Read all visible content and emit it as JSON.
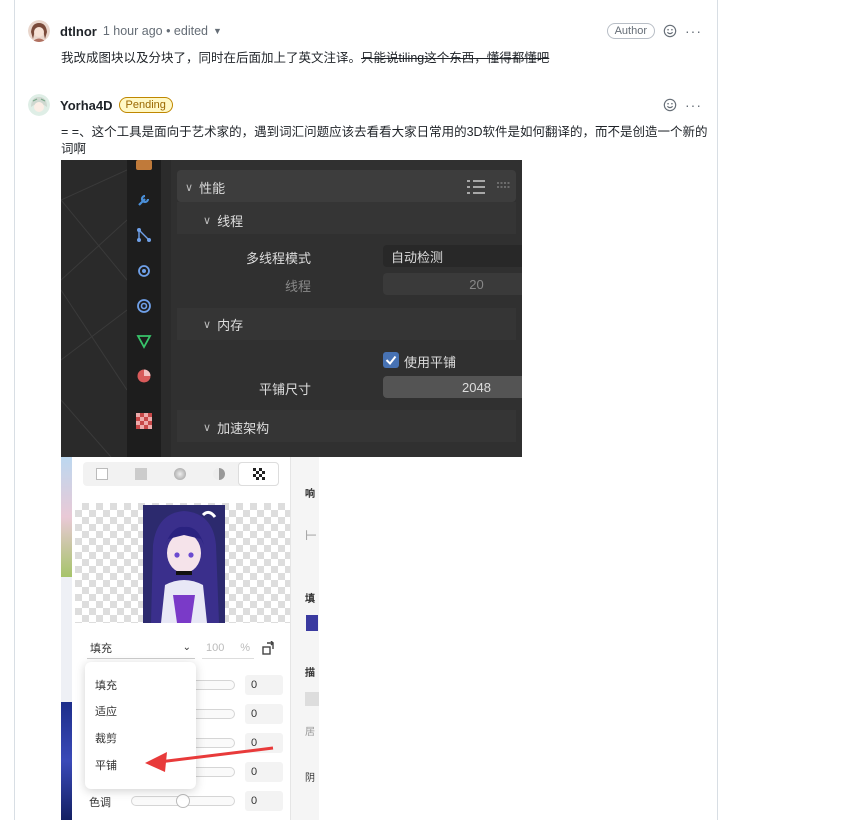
{
  "comments": [
    {
      "author": "dtlnor",
      "meta": "1 hour ago • edited",
      "badge": "Author",
      "body_plain": "我改成图块以及分块了，同时在后面加上了英文注译。",
      "body_struck": "只能说tiling这个东西，懂得都懂吧"
    },
    {
      "author": "Yorha4D",
      "badge": "Pending",
      "body": "= =、这个工具是面向于艺术家的，遇到词汇问题应该去看看大家日常用的3D软件是如何翻译的，而不是创造一个新的词啊"
    }
  ],
  "blender": {
    "section_perf": "性能",
    "sub_thread": "线程",
    "label_mt_mode": "多线程模式",
    "mt_mode_value": "自动检测",
    "label_threads": "线程",
    "threads_value": "20",
    "sub_memory": "内存",
    "use_tiling_label": "使用平铺",
    "label_tile_size": "平铺尺寸",
    "tile_size_value": "2048",
    "sub_accel": "加速架构"
  },
  "fill_panel": {
    "selected_mode": "填充",
    "percent_value": "100",
    "percent_unit": "%",
    "menu_items": [
      "填充",
      "适应",
      "裁剪",
      "平铺"
    ],
    "slider_values": [
      "0",
      "0",
      "0",
      "0",
      "0"
    ],
    "hue_label": "色调",
    "right_labels": [
      "响",
      "填",
      "描",
      "居",
      "阴"
    ]
  },
  "colors": {
    "accent_blue": "#4772b3",
    "arrow_red": "#e83a3a",
    "pending_bg": "#fff8c5"
  }
}
